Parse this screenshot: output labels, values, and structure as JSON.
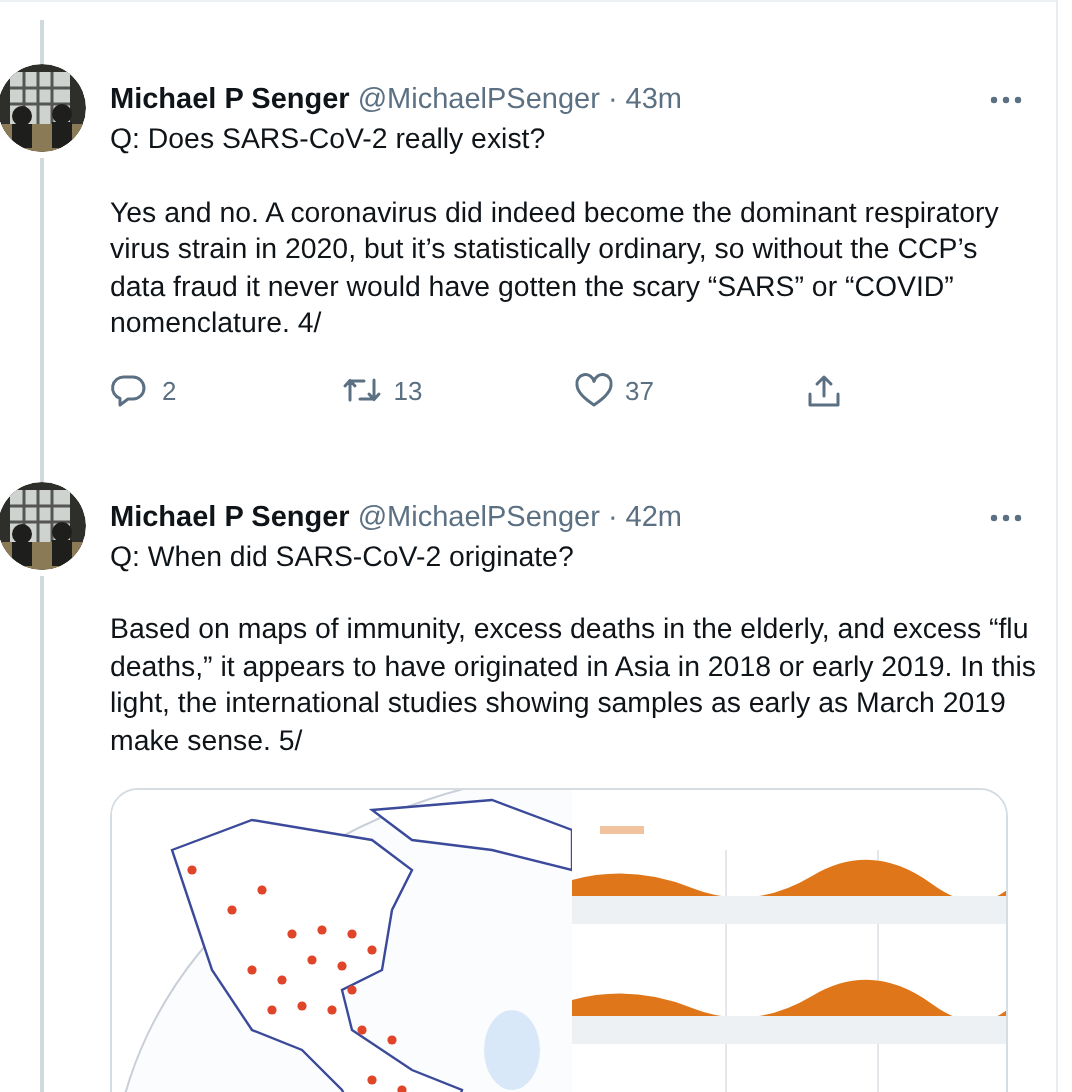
{
  "tweets": [
    {
      "name": "Michael P Senger",
      "handle": "@MichaelPSenger",
      "dot": "·",
      "time": "43m",
      "paragraphs": [
        "Q: Does SARS-CoV-2 really exist?",
        "Yes and no. A coronavirus did indeed become the dominant respiratory virus strain in 2020, but it’s statistically ordinary, so without the CCP’s data fraud it never would have gotten the scary “SARS” or “COVID” nomenclature. 4/"
      ],
      "actions": [
        {
          "kind": "reply",
          "count": "2"
        },
        {
          "kind": "retweet",
          "count": "13"
        },
        {
          "kind": "like",
          "count": "37"
        },
        {
          "kind": "share"
        }
      ]
    },
    {
      "name": "Michael P Senger",
      "handle": "@MichaelPSenger",
      "dot": "·",
      "time": "42m",
      "paragraphs": [
        "Q: When did SARS-CoV-2 originate?",
        "Based on maps of immunity, excess deaths in the elderly, and excess “flu deaths,” it appears to have originated in Asia in 2018 or early 2019. In this light, the international studies showing samples as early as March 2019 make sense. 5/"
      ]
    }
  ]
}
